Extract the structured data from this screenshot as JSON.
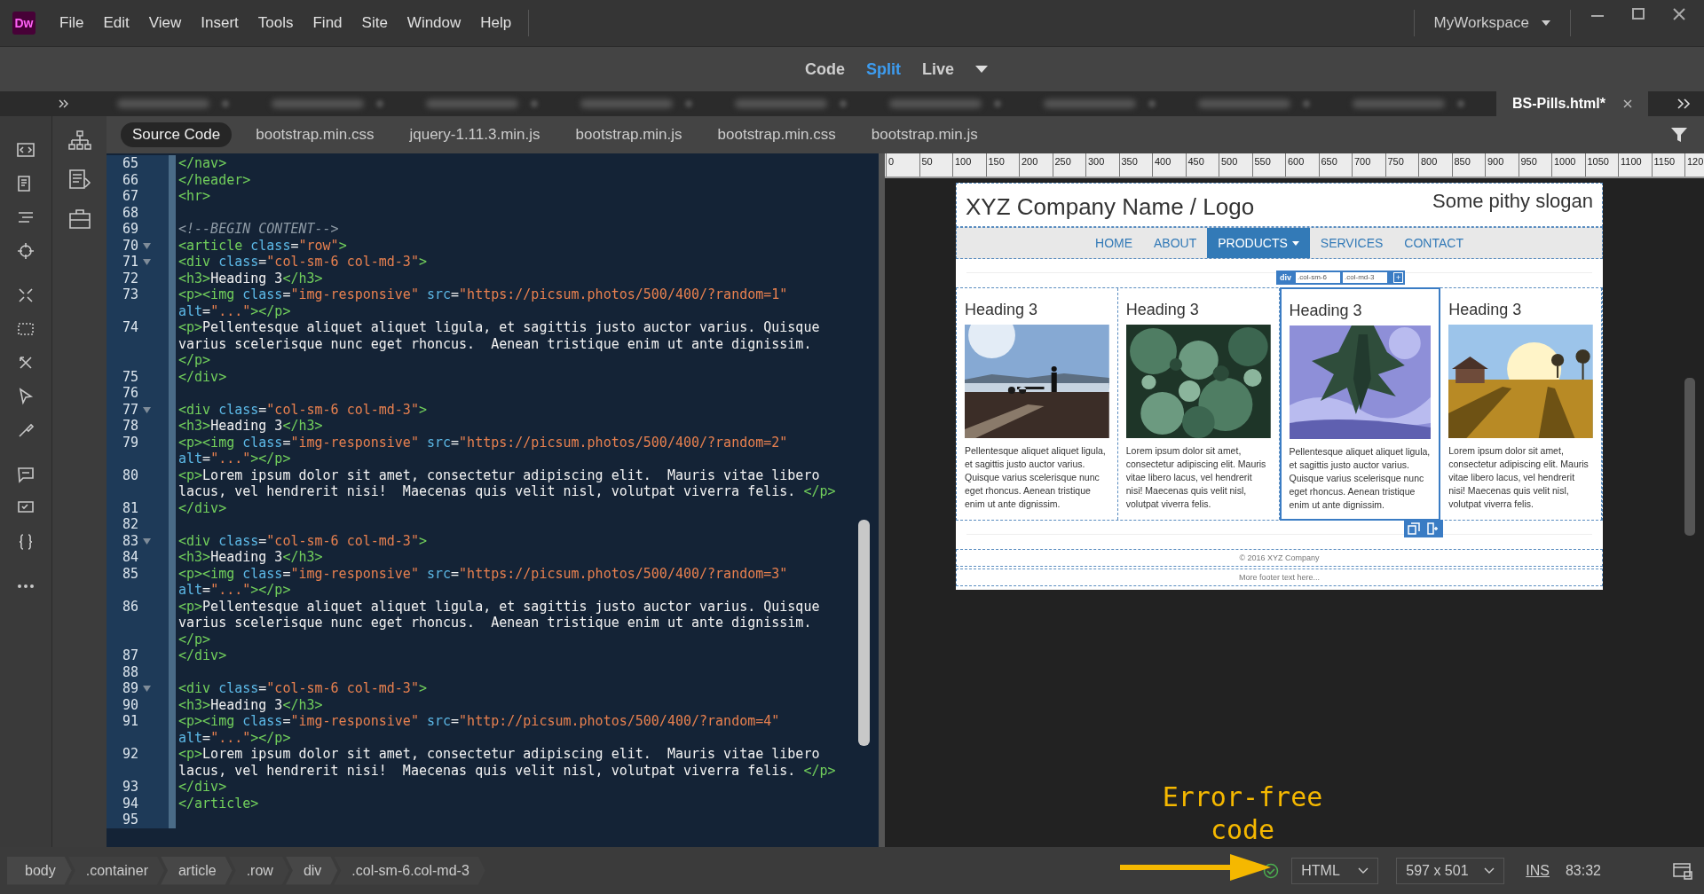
{
  "app_logo": "Dw",
  "menu": [
    "File",
    "Edit",
    "View",
    "Insert",
    "Tools",
    "Find",
    "Site",
    "Window",
    "Help"
  ],
  "workspace": {
    "label": "MyWorkspace"
  },
  "views": [
    {
      "label": "Code",
      "selected": false
    },
    {
      "label": "Split",
      "selected": true
    },
    {
      "label": "Live",
      "selected": false
    }
  ],
  "document_tabs": [
    {
      "kind": "blurred",
      "selected": false
    },
    {
      "kind": "blurred",
      "selected": false
    },
    {
      "kind": "blurred",
      "selected": false
    },
    {
      "kind": "blurred",
      "selected": false
    },
    {
      "kind": "blurred",
      "selected": false
    },
    {
      "kind": "blurred",
      "selected": false
    },
    {
      "kind": "blurred",
      "selected": false
    },
    {
      "kind": "blurred",
      "selected": false
    },
    {
      "kind": "blurred",
      "selected": false
    },
    {
      "kind": "file",
      "label": "BS-Pills.html*",
      "selected": true
    }
  ],
  "related_files": [
    {
      "label": "Source Code",
      "selected": true
    },
    {
      "label": "bootstrap.min.css",
      "selected": false
    },
    {
      "label": "jquery-1.11.3.min.js",
      "selected": false
    },
    {
      "label": "bootstrap.min.js",
      "selected": false
    },
    {
      "label": "bootstrap.min.css",
      "selected": false
    },
    {
      "label": "bootstrap.min.js",
      "selected": false
    }
  ],
  "code": {
    "lines": [
      {
        "num": "65",
        "fold": false,
        "tokens": [
          {
            "kind": "tag",
            "text": "</nav>"
          }
        ]
      },
      {
        "num": "66",
        "fold": false,
        "tokens": [
          {
            "kind": "tag",
            "text": "</header>"
          }
        ]
      },
      {
        "num": "67",
        "fold": false,
        "tokens": [
          {
            "kind": "tag",
            "text": "<hr>"
          }
        ]
      },
      {
        "num": "68",
        "fold": false
      },
      {
        "num": "69",
        "fold": false,
        "tokens": [
          {
            "kind": "comment",
            "text": "<!--BEGIN CONTENT-->"
          }
        ]
      },
      {
        "num": "70",
        "fold": true,
        "tokens": [
          {
            "kind": "tag",
            "text": "<article "
          },
          {
            "kind": "attr",
            "text": "class"
          },
          {
            "kind": "text",
            "text": "="
          },
          {
            "kind": "str",
            "text": "\"row\""
          },
          {
            "kind": "tag",
            "text": ">"
          }
        ]
      },
      {
        "num": "71",
        "fold": true,
        "tokens": [
          {
            "kind": "tag",
            "text": "<div "
          },
          {
            "kind": "attr",
            "text": "class"
          },
          {
            "kind": "text",
            "text": "="
          },
          {
            "kind": "str",
            "text": "\"col-sm-6 col-md-3\""
          },
          {
            "kind": "tag",
            "text": ">"
          }
        ]
      },
      {
        "num": "72",
        "fold": false,
        "tokens": [
          {
            "kind": "tag",
            "text": "<h3>"
          },
          {
            "kind": "text",
            "text": "Heading 3"
          },
          {
            "kind": "tag",
            "text": "</h3>"
          }
        ]
      },
      {
        "num": "73",
        "fold": false,
        "tokens": [
          {
            "kind": "tag",
            "text": "<p><img "
          },
          {
            "kind": "attr",
            "text": "class"
          },
          {
            "kind": "text",
            "text": "="
          },
          {
            "kind": "str",
            "text": "\"img-responsive\""
          },
          {
            "kind": "attr",
            "text": " src"
          },
          {
            "kind": "text",
            "text": "="
          },
          {
            "kind": "str",
            "text": "\"https://picsum.photos/500/400/?random=1\""
          },
          {
            "kind": "attr",
            "text": " alt"
          },
          {
            "kind": "text",
            "text": "="
          },
          {
            "kind": "str",
            "text": "\"...\""
          },
          {
            "kind": "tag",
            "text": "></p>"
          }
        ]
      },
      {
        "num": "74",
        "fold": false,
        "tokens": [
          {
            "kind": "tag",
            "text": "<p>"
          },
          {
            "kind": "text",
            "text": "Pellentesque aliquet aliquet ligula, et sagittis justo auctor varius. Quisque varius scelerisque nunc eget rhoncus.  Aenean tristique enim ut ante dignissim. "
          },
          {
            "kind": "tag",
            "text": "</p>"
          }
        ]
      },
      {
        "num": "75",
        "fold": false,
        "tokens": [
          {
            "kind": "tag",
            "text": "</div>"
          }
        ]
      },
      {
        "num": "76",
        "fold": false
      },
      {
        "num": "77",
        "fold": true,
        "tokens": [
          {
            "kind": "tag",
            "text": "<div "
          },
          {
            "kind": "attr",
            "text": "class"
          },
          {
            "kind": "text",
            "text": "="
          },
          {
            "kind": "str",
            "text": "\"col-sm-6 col-md-3\""
          },
          {
            "kind": "tag",
            "text": ">"
          }
        ]
      },
      {
        "num": "78",
        "fold": false,
        "tokens": [
          {
            "kind": "tag",
            "text": "<h3>"
          },
          {
            "kind": "text",
            "text": "Heading 3"
          },
          {
            "kind": "tag",
            "text": "</h3>"
          }
        ]
      },
      {
        "num": "79",
        "fold": false,
        "tokens": [
          {
            "kind": "tag",
            "text": "<p><img "
          },
          {
            "kind": "attr",
            "text": "class"
          },
          {
            "kind": "text",
            "text": "="
          },
          {
            "kind": "str",
            "text": "\"img-responsive\""
          },
          {
            "kind": "attr",
            "text": " src"
          },
          {
            "kind": "text",
            "text": "="
          },
          {
            "kind": "str",
            "text": "\"https://picsum.photos/500/400/?random=2\""
          },
          {
            "kind": "attr",
            "text": " alt"
          },
          {
            "kind": "text",
            "text": "="
          },
          {
            "kind": "str",
            "text": "\"...\""
          },
          {
            "kind": "tag",
            "text": "></p>"
          }
        ]
      },
      {
        "num": "80",
        "fold": false,
        "tokens": [
          {
            "kind": "tag",
            "text": "<p>"
          },
          {
            "kind": "text",
            "text": "Lorem ipsum dolor sit amet, consectetur adipiscing elit.  Mauris vitae libero lacus, vel hendrerit nisi!  Maecenas quis velit nisl, volutpat viverra felis. "
          },
          {
            "kind": "tag",
            "text": "</p>"
          }
        ]
      },
      {
        "num": "81",
        "fold": false,
        "tokens": [
          {
            "kind": "tag",
            "text": "</div>"
          }
        ]
      },
      {
        "num": "82",
        "fold": false
      },
      {
        "num": "83",
        "fold": true,
        "tokens": [
          {
            "kind": "tag",
            "text": "<div "
          },
          {
            "kind": "attr",
            "text": "class"
          },
          {
            "kind": "text",
            "text": "="
          },
          {
            "kind": "str",
            "text": "\"col-sm-6 col-md-3\""
          },
          {
            "kind": "tag",
            "text": ">"
          }
        ]
      },
      {
        "num": "84",
        "fold": false,
        "tokens": [
          {
            "kind": "tag",
            "text": "<h3>"
          },
          {
            "kind": "text",
            "text": "Heading 3"
          },
          {
            "kind": "tag",
            "text": "</h3>"
          }
        ]
      },
      {
        "num": "85",
        "fold": false,
        "tokens": [
          {
            "kind": "tag",
            "text": "<p><img "
          },
          {
            "kind": "attr",
            "text": "class"
          },
          {
            "kind": "text",
            "text": "="
          },
          {
            "kind": "str",
            "text": "\"img-responsive\""
          },
          {
            "kind": "attr",
            "text": " src"
          },
          {
            "kind": "text",
            "text": "="
          },
          {
            "kind": "str",
            "text": "\"https://picsum.photos/500/400/?random=3\""
          },
          {
            "kind": "attr",
            "text": " alt"
          },
          {
            "kind": "text",
            "text": "="
          },
          {
            "kind": "str",
            "text": "\"...\""
          },
          {
            "kind": "tag",
            "text": "></p>"
          }
        ]
      },
      {
        "num": "86",
        "fold": false,
        "tokens": [
          {
            "kind": "tag",
            "text": "<p>"
          },
          {
            "kind": "text",
            "text": "Pellentesque aliquet aliquet ligula, et sagittis justo auctor varius. Quisque varius scelerisque nunc eget rhoncus.  Aenean tristique enim ut ante dignissim. "
          },
          {
            "kind": "tag",
            "text": "</p>"
          }
        ]
      },
      {
        "num": "87",
        "fold": false,
        "tokens": [
          {
            "kind": "tag",
            "text": "</div>"
          }
        ]
      },
      {
        "num": "88",
        "fold": false
      },
      {
        "num": "89",
        "fold": true,
        "tokens": [
          {
            "kind": "tag",
            "text": "<div "
          },
          {
            "kind": "attr",
            "text": "class"
          },
          {
            "kind": "text",
            "text": "="
          },
          {
            "kind": "str",
            "text": "\"col-sm-6 col-md-3\""
          },
          {
            "kind": "tag",
            "text": ">"
          }
        ]
      },
      {
        "num": "90",
        "fold": false,
        "tokens": [
          {
            "kind": "tag",
            "text": "<h3>"
          },
          {
            "kind": "text",
            "text": "Heading 3"
          },
          {
            "kind": "tag",
            "text": "</h3>"
          }
        ]
      },
      {
        "num": "91",
        "fold": false,
        "tokens": [
          {
            "kind": "tag",
            "text": "<p><img "
          },
          {
            "kind": "attr",
            "text": "class"
          },
          {
            "kind": "text",
            "text": "="
          },
          {
            "kind": "str",
            "text": "\"img-responsive\""
          },
          {
            "kind": "attr",
            "text": " src"
          },
          {
            "kind": "text",
            "text": "="
          },
          {
            "kind": "str",
            "text": "\"http://picsum.photos/500/400/?random=4\""
          },
          {
            "kind": "attr",
            "text": " alt"
          },
          {
            "kind": "text",
            "text": "="
          },
          {
            "kind": "str",
            "text": "\"...\""
          },
          {
            "kind": "tag",
            "text": "></p>"
          }
        ]
      },
      {
        "num": "92",
        "fold": false,
        "tokens": [
          {
            "kind": "tag",
            "text": "<p>"
          },
          {
            "kind": "text",
            "text": "Lorem ipsum dolor sit amet, consectetur adipiscing elit.  Mauris vitae libero lacus, vel hendrerit nisi!  Maecenas quis velit nisl, volutpat viverra felis. "
          },
          {
            "kind": "tag",
            "text": "</p>"
          }
        ]
      },
      {
        "num": "93",
        "fold": false,
        "tokens": [
          {
            "kind": "tag",
            "text": "</div>"
          }
        ]
      },
      {
        "num": "94",
        "fold": false,
        "tokens": [
          {
            "kind": "tag",
            "text": "</article>"
          }
        ]
      },
      {
        "num": "95",
        "fold": false
      }
    ]
  },
  "preview": {
    "ruler": [
      "0",
      "50",
      "100",
      "150",
      "200",
      "250",
      "300",
      "350",
      "400",
      "450",
      "500",
      "550",
      "600",
      "650",
      "700",
      "750",
      "800",
      "850",
      "900",
      "950",
      "1000",
      "1050",
      "1100",
      "1150",
      "120"
    ],
    "page": {
      "title": "XYZ Company Name / Logo",
      "slogan": "Some pithy slogan",
      "nav": [
        {
          "label": "HOME",
          "selected": false,
          "dropdown": false
        },
        {
          "label": "ABOUT",
          "selected": false,
          "dropdown": false
        },
        {
          "label": "PRODUCTS",
          "selected": true,
          "dropdown": true
        },
        {
          "label": "SERVICES",
          "selected": false,
          "dropdown": false
        },
        {
          "label": "CONTACT",
          "selected": false,
          "dropdown": false
        }
      ],
      "selector": {
        "tag": "div",
        "classes": [
          ".col-sm-6",
          ".col-md-3"
        ],
        "add": "+"
      },
      "columns": [
        {
          "heading": "Heading 3",
          "text": "Pellentesque aliquet aliquet ligula, et sagittis justo auctor varius. Quisque varius scelerisque nunc eget rhoncus. Aenean tristique enim ut ante dignissim.",
          "selected": false
        },
        {
          "heading": "Heading 3",
          "text": "Lorem ipsum dolor sit amet, consectetur adipiscing elit. Mauris vitae libero lacus, vel hendrerit nisi! Maecenas quis velit nisl, volutpat viverra felis.",
          "selected": false
        },
        {
          "heading": "Heading 3",
          "text": "Pellentesque aliquet aliquet ligula, et sagittis justo auctor varius. Quisque varius scelerisque nunc eget rhoncus. Aenean tristique enim ut ante dignissim.",
          "selected": true
        },
        {
          "heading": "Heading 3",
          "text": "Lorem ipsum dolor sit amet, consectetur adipiscing elit. Mauris vitae libero lacus, vel hendrerit nisi! Maecenas quis velit nisl, volutpat viverra felis.",
          "selected": false
        }
      ],
      "footer": [
        "© 2016 XYZ Company",
        "More footer text here..."
      ]
    }
  },
  "status_bar": {
    "breadcrumbs": [
      "body",
      ".container",
      "article",
      ".row",
      "div",
      ".col-sm-6.col-md-3"
    ],
    "language": "HTML",
    "size": "597 x 501",
    "mode": "INS",
    "position": "83:32"
  },
  "annotation": {
    "text": "Error-free code"
  }
}
